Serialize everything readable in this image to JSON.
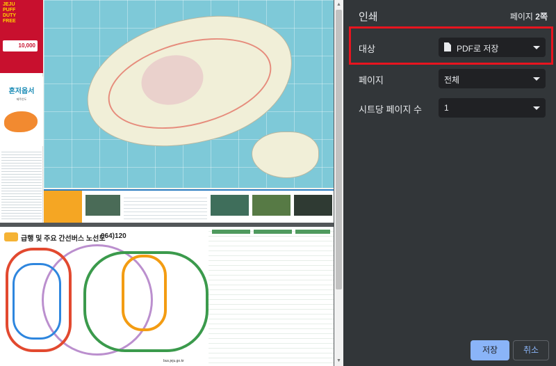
{
  "print_dialog": {
    "title": "인쇄",
    "page_count_prefix": "페이지 ",
    "page_count_value": "2쪽",
    "destination": {
      "label": "대상",
      "value": "PDF로 저장",
      "icon": "file-icon"
    },
    "pages": {
      "label": "페이지",
      "value": "전체"
    },
    "pages_per_sheet": {
      "label": "시트당 페이지 수",
      "value": "1"
    },
    "save_label": "저장",
    "cancel_label": "취소",
    "highlight_color": "#e8141f",
    "accent_color": "#8ab4f8"
  },
  "preview": {
    "page1": {
      "ad_brand": "JEJU PUFF DUTY FREE",
      "ad_coupon": "10,000",
      "guide_title": "혼저옵서",
      "guide_subtitle": "제주안도"
    },
    "page2": {
      "title": "급행 및 주요 간선버스 노선도",
      "phone": "064)120",
      "url": "bus.jeju.go.kr"
    }
  }
}
